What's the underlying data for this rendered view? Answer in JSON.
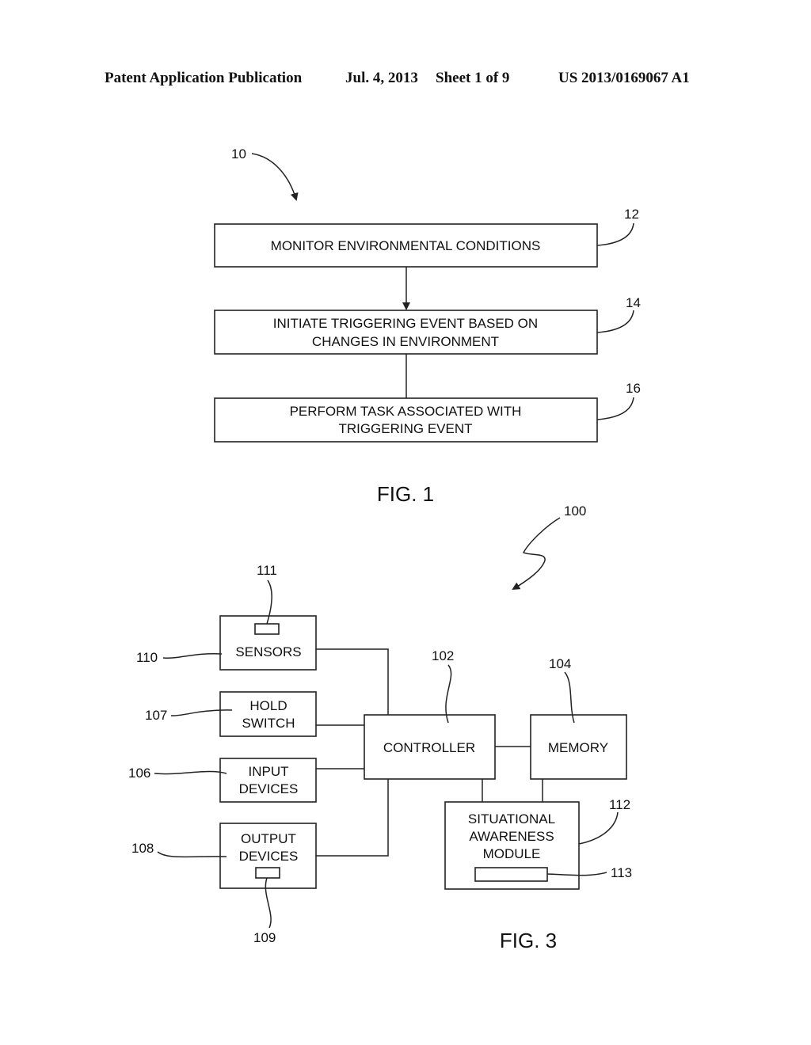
{
  "header": {
    "left": "Patent Application Publication",
    "date": "Jul. 4, 2013",
    "sheet": "Sheet 1 of 9",
    "number": "US 2013/0169067 A1"
  },
  "fig1": {
    "caption": "FIG. 1",
    "ref": "10",
    "steps": [
      {
        "ref": "12",
        "lines": [
          "MONITOR ENVIRONMENTAL CONDITIONS"
        ]
      },
      {
        "ref": "14",
        "lines": [
          "INITIATE TRIGGERING EVENT BASED ON",
          "CHANGES IN ENVIRONMENT"
        ]
      },
      {
        "ref": "16",
        "lines": [
          "PERFORM TASK ASSOCIATED WITH",
          "TRIGGERING EVENT"
        ]
      }
    ]
  },
  "fig3": {
    "caption": "FIG. 3",
    "ref": "100",
    "sensors": {
      "ref": "110",
      "sub_ref": "111",
      "lines": [
        "SENSORS"
      ]
    },
    "hold_switch": {
      "ref": "107",
      "lines": [
        "HOLD",
        "SWITCH"
      ]
    },
    "input_devices": {
      "ref": "106",
      "lines": [
        "INPUT",
        "DEVICES"
      ]
    },
    "output_devices": {
      "ref": "108",
      "sub_ref": "109",
      "lines": [
        "OUTPUT",
        "DEVICES"
      ]
    },
    "controller": {
      "ref": "102",
      "lines": [
        "CONTROLLER"
      ]
    },
    "memory": {
      "ref": "104",
      "lines": [
        "MEMORY"
      ]
    },
    "sam": {
      "ref": "112",
      "sub_ref": "113",
      "lines": [
        "SITUATIONAL",
        "AWARENESS",
        "MODULE"
      ]
    }
  }
}
